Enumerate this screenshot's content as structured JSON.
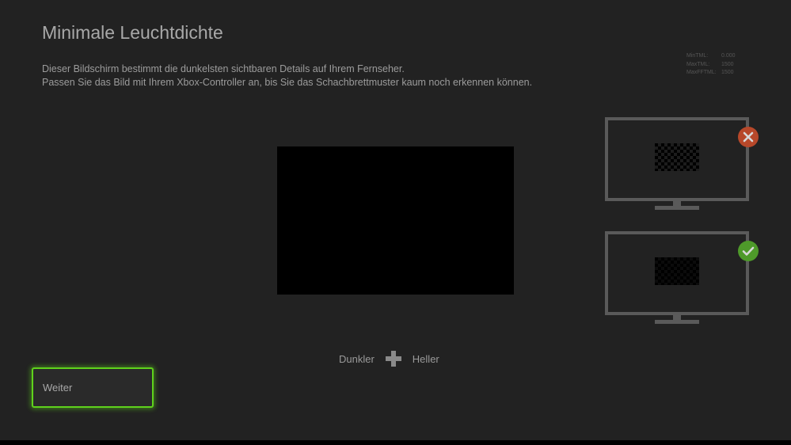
{
  "page": {
    "title": "Minimale Leuchtdichte",
    "description": [
      "Dieser Bildschirm bestimmt die dunkelsten sichtbaren Details auf Ihrem Fernseher.",
      "Passen Sie das Bild mit Ihrem Xbox-Controller an, bis Sie das Schachbrettmuster kaum noch erkennen können."
    ]
  },
  "stats": [
    {
      "label": "MinTML:",
      "value": "0.000"
    },
    {
      "label": "MaxTML:",
      "value": "1500"
    },
    {
      "label": "MaxFFTML:",
      "value": "1500"
    }
  ],
  "examples": {
    "bad_icon": "close-icon",
    "good_icon": "checkmark-icon"
  },
  "slider": {
    "left_label": "Dunkler",
    "right_label": "Heller",
    "icon": "plus-icon"
  },
  "next_button": {
    "label": "Weiter"
  },
  "colors": {
    "background": "#222222",
    "accent_focus": "#5fd21c",
    "bad_badge": "#b7482a",
    "good_badge": "#4e9a2a",
    "tv_outline": "#5a5a5a"
  }
}
